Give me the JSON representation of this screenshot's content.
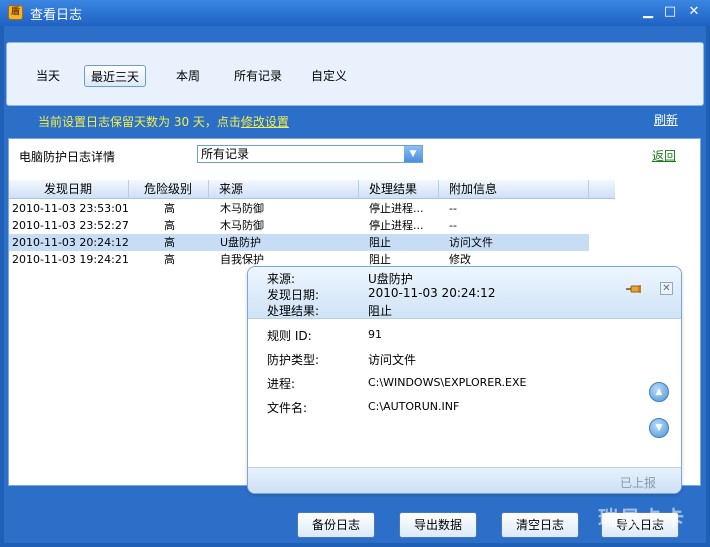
{
  "window": {
    "title": "查看日志",
    "icon": "shield-icon",
    "minimize": "▁",
    "maximize": "□",
    "close": "✕"
  },
  "tabs": [
    {
      "label": "当天",
      "active": false
    },
    {
      "label": "最近三天",
      "active": true
    },
    {
      "label": "本周",
      "active": false
    },
    {
      "label": "所有记录",
      "active": false
    },
    {
      "label": "自定义",
      "active": false
    }
  ],
  "notice": {
    "prefix": "当前设置日志保留天数为 30 天，点击",
    "link": "修改设置"
  },
  "refresh_label": "刷新",
  "detail": {
    "label": "电脑防护日志详情",
    "filter_value": "所有记录",
    "back_label": "返回"
  },
  "table": {
    "headers": [
      "发现日期",
      "危险级别",
      "来源",
      "处理结果",
      "附加信息"
    ],
    "rows": [
      {
        "date": "2010-11-03 23:53:01",
        "level": "高",
        "source": "木马防御",
        "result": "停止进程...",
        "info": "--"
      },
      {
        "date": "2010-11-03 23:52:27",
        "level": "高",
        "source": "木马防御",
        "result": "停止进程...",
        "info": "--"
      },
      {
        "date": "2010-11-03 20:24:12",
        "level": "高",
        "source": "U盘防护",
        "result": "阻止",
        "info": "访问文件"
      },
      {
        "date": "2010-11-03 19:24:21",
        "level": "高",
        "source": "自我保护",
        "result": "阻止",
        "info": "修改"
      }
    ]
  },
  "popup": {
    "source_label": "来源:",
    "source_value": "U盘防护",
    "date_label": "发现日期:",
    "date_value": "2010-11-03 20:24:12",
    "result_label": "处理结果:",
    "result_value": "阻止",
    "rule_label": "规则 ID:",
    "rule_value": "91",
    "type_label": "防护类型:",
    "type_value": "访问文件",
    "process_label": "进程:",
    "process_value": "C:\\WINDOWS\\EXPLORER.EXE",
    "file_label": "文件名:",
    "file_value": "C:\\AUTORUN.INF",
    "reported": "已上报"
  },
  "buttons": {
    "backup": "备份日志",
    "export": "导出数据",
    "clear": "清空日志",
    "import": "导入日志"
  },
  "watermark": "瑞星卡卡",
  "colors": {
    "titlebar": "#2a74d6",
    "notice": "#f4f04a",
    "selected_row": "#c7ddf5",
    "back_link": "#1a7b1a"
  }
}
